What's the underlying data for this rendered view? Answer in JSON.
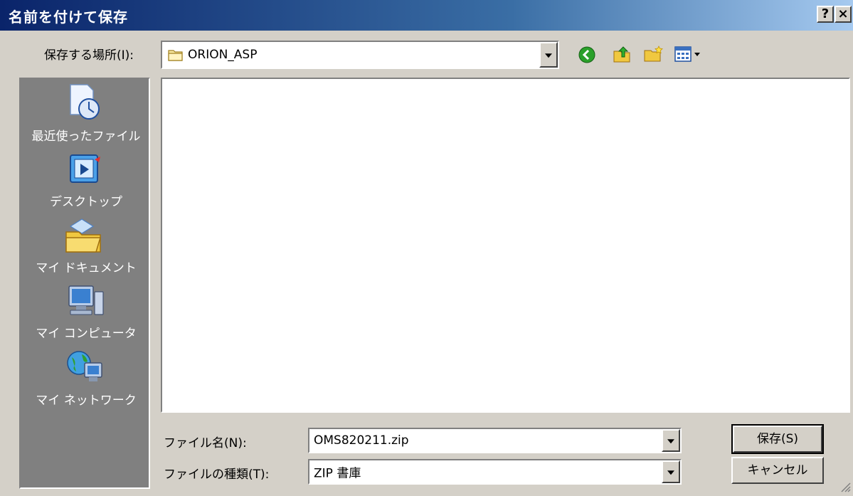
{
  "window": {
    "title": "名前を付けて保存",
    "help_label": "?",
    "close_label": "×"
  },
  "location": {
    "label": "保存する場所(I):",
    "value": "ORION_ASP"
  },
  "toolbar": {
    "icons": [
      "back-icon",
      "up-folder-icon",
      "new-folder-icon",
      "view-menu-icon"
    ]
  },
  "places": [
    {
      "label": "最近使ったファイル",
      "icon": "recent-files-icon"
    },
    {
      "label": "デスクトップ",
      "icon": "desktop-icon"
    },
    {
      "label": "マイ ドキュメント",
      "icon": "my-documents-icon"
    },
    {
      "label": "マイ コンピュータ",
      "icon": "my-computer-icon"
    },
    {
      "label": "マイ ネットワーク",
      "icon": "my-network-icon"
    }
  ],
  "filename": {
    "label": "ファイル名(N):",
    "value": "OMS820211.zip"
  },
  "filetype": {
    "label": "ファイルの種類(T):",
    "value": "ZIP 書庫"
  },
  "buttons": {
    "save": "保存(S)",
    "cancel": "キャンセル"
  }
}
